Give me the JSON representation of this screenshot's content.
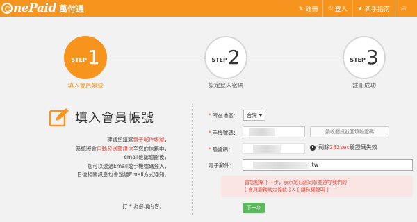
{
  "header": {
    "logo_text": "nePaid",
    "logo_sub": "萬付通",
    "nav": [
      {
        "icon": "✎",
        "label": "註冊"
      },
      {
        "icon": "⏻",
        "label": "登入"
      },
      {
        "icon": "★",
        "label": "新手指南"
      },
      {
        "icon": "☏",
        "label": ""
      }
    ]
  },
  "steps": [
    {
      "word": "STEP",
      "num": "1",
      "label": "填入會員帳號",
      "active": true
    },
    {
      "word": "STEP",
      "num": "2",
      "label": "設定登入密碼",
      "active": false
    },
    {
      "word": "STEP",
      "num": "3",
      "label": "註冊成功",
      "active": false
    }
  ],
  "left": {
    "title": "填入會員帳號",
    "notes": {
      "l1a": "建議您填寫",
      "l1b": "電子郵件帳號",
      "l1c": "，",
      "l2a": "系統將會",
      "l2b": "自動發送驗證信",
      "l2c": "至您的信箱中，",
      "l3": "email確認驗證後，",
      "l4": "您可以透過Email或手機號碼登入，",
      "l5": "日後相關訊息也會透過Email方式通知。"
    },
    "required_note": "打 * 為必填內容。"
  },
  "form": {
    "region_label": "所在地區：",
    "region_value": "台灣",
    "phone_label": "手機號碼：",
    "sms_button": "請收簡訊並回填驗證碼",
    "code_label": "驗證碼：",
    "countdown_prefix": "剩餘",
    "countdown_secs": "282sec",
    "countdown_suffix": "驗證碼失效",
    "email_label": "電子郵件：",
    "email_value": ".tw",
    "terms_line1": "當您點擊下一步，表示您已經同意並遵守我們的",
    "terms_open": "[",
    "terms_link1": "會員服務約定條款",
    "terms_mid": "] & [",
    "terms_link2": "隱私權聲明",
    "terms_close": "]",
    "next_button": "下一步"
  },
  "colors": {
    "brand": "#f7941d",
    "alert": "#e74c3c",
    "next": "#5cb85c"
  }
}
